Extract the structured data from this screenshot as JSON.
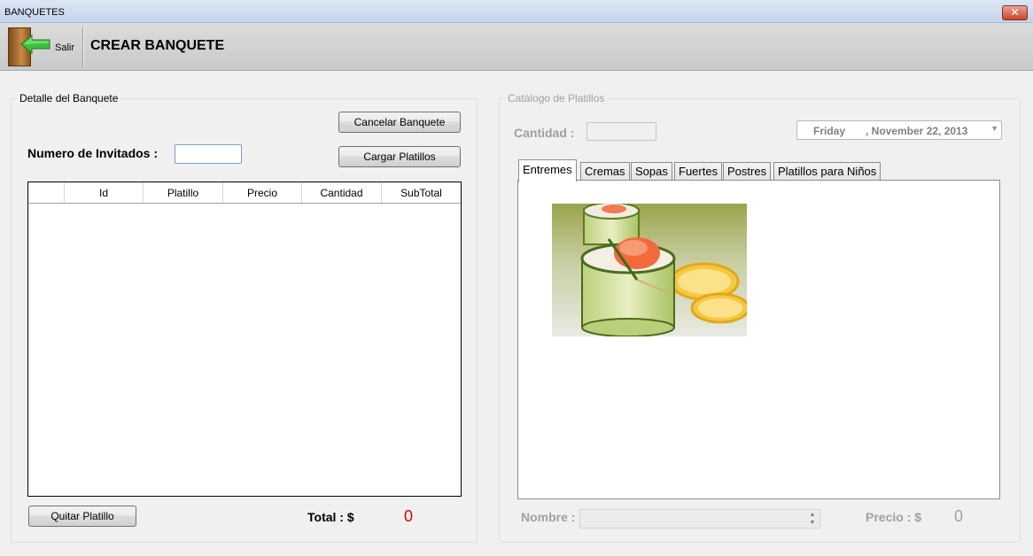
{
  "window": {
    "title": "BANQUETES",
    "close_glyph": "✕"
  },
  "toolbar": {
    "exit_label": "Salir",
    "page_title": "CREAR BANQUETE"
  },
  "detalle": {
    "legend": "Detalle del Banquete",
    "cancel_button": "Cancelar Banquete",
    "load_button": "Cargar Platillos",
    "guests_label": "Numero de Invitados :",
    "guests_value": "",
    "columns": [
      "",
      "Id",
      "Platillo",
      "Precio",
      "Cantidad",
      "SubTotal"
    ],
    "rows": [],
    "remove_button": "Quitar Platillo",
    "total_label": "Total : $",
    "total_value": "0"
  },
  "catalogo": {
    "legend": "Catálogo de Platillos",
    "quantity_label": "Cantidad :",
    "quantity_value": "",
    "date": {
      "day": "Friday",
      "date": ",  November  22, 2013"
    },
    "tabs": [
      "Entremes",
      "Cremas",
      "Sopas",
      "Fuertes",
      "Postres",
      "Platillos para Niños"
    ],
    "active_tab": "Entremes",
    "name_label": "Nombre :",
    "name_value": "",
    "price_label": "Precio : $",
    "price_value": "0"
  },
  "icons": {
    "exit": "exit-door-icon",
    "close": "close-icon",
    "dropdown": "chevron-down-icon"
  },
  "colors": {
    "total": "#e00000",
    "disabled_text": "#a0a0a0",
    "titlebar": "#c4d5ec"
  }
}
